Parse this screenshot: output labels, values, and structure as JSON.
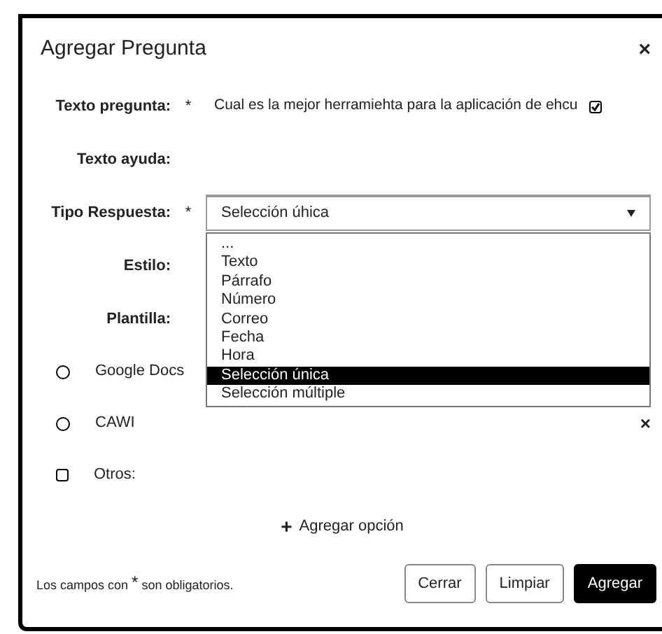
{
  "dialog": {
    "title": "Agregar Pregunta",
    "close": "×"
  },
  "fields": [
    {
      "label": "Texto pregunta:",
      "required": true,
      "kind": "text",
      "value": "Cual es la mejor herramiehta para la aplicación de ehcu",
      "checked": true
    },
    {
      "label": "Texto ayuda:",
      "required": false,
      "kind": "empty"
    },
    {
      "label": "Tipo Respuesta:",
      "required": true,
      "kind": "select",
      "value": "Selección úhica",
      "expanded": true,
      "options": [
        {
          "label": "...",
          "selected": false
        },
        {
          "label": "Texto",
          "selected": false
        },
        {
          "label": "Párrafo",
          "selected": false
        },
        {
          "label": "Número",
          "selected": false
        },
        {
          "label": "Correo",
          "selected": false
        },
        {
          "label": "Fecha",
          "selected": false
        },
        {
          "label": "Hora",
          "selected": false
        },
        {
          "label": "Selección única",
          "selected": true
        },
        {
          "label": "Selección múltiple",
          "selected": false
        }
      ]
    },
    {
      "label": "Estilo:",
      "required": false,
      "kind": "empty"
    },
    {
      "label": "Plantilla:",
      "required": false,
      "kind": "empty"
    }
  ],
  "choices": [
    {
      "kind": "radio",
      "label": "Google Docs",
      "selected": false
    },
    {
      "kind": "radio",
      "label": "CAWI",
      "remove": "×",
      "selected": false
    },
    {
      "kind": "checkbox",
      "label": "Otros:",
      "checked": false
    }
  ],
  "add_option": {
    "icon": "+",
    "label": "Agregar opción"
  },
  "footer": {
    "note_before": "Los campos con",
    "note_mark": "*",
    "note_after": "son obligatorios.",
    "buttons": [
      {
        "label": "Cerrar",
        "primary": false
      },
      {
        "label": "Limpiar",
        "primary": false
      },
      {
        "label": "Agregar",
        "primary": true
      }
    ]
  }
}
